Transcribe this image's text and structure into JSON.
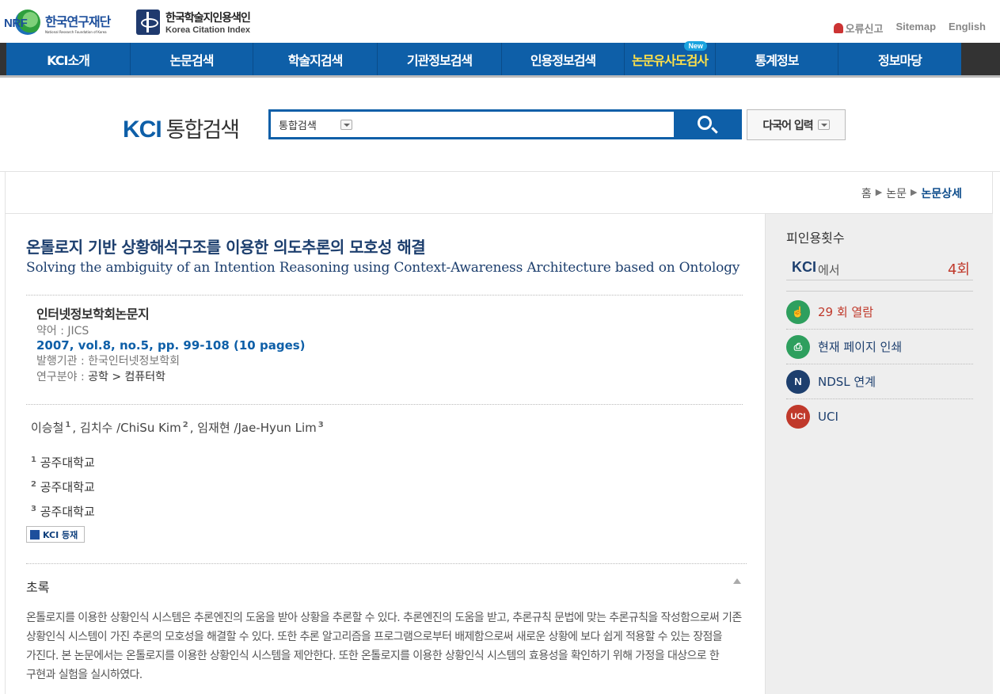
{
  "header": {
    "nrf_mark": "NRF",
    "nrf_name_ko": "한국연구재단",
    "nrf_name_en": "National Research Foundation of Korea",
    "kci_name_ko": "한국학술지인용색인",
    "kci_name_en": "Korea Citation Index",
    "util": {
      "report": "오류신고",
      "sitemap": "Sitemap",
      "english": "English"
    }
  },
  "nav": {
    "items": [
      "KCI소개",
      "논문검색",
      "학술지검색",
      "기관정보검색",
      "인용정보검색",
      "논문유사도검사",
      "통계정보",
      "정보마당"
    ],
    "new_badge": "New"
  },
  "search": {
    "logo_kci": "KCI",
    "logo_text": "통합검색",
    "scope": "통합검색",
    "multi_input": "다국어 입력"
  },
  "breadcrumb": [
    "홈",
    "논문",
    "논문상세"
  ],
  "article": {
    "title_ko": "온톨로지 기반 상황해석구조를 이용한 의도추론의 모호성 해결",
    "title_en": "Solving the ambiguity of an Intention Reasoning using Context-Awareness Architecture based on Ontology",
    "journal": "인터넷정보학회논문지",
    "abbr": "약어 : JICS",
    "volume": "2007, vol.8, no.5, pp. 99-108 (10 pages)",
    "publisher": "발행기관 : 한국인터넷정보학회",
    "field_label": "연구분야 : ",
    "field_value": "공학 > 컴퓨터학",
    "authors": [
      {
        "name": "이승철",
        "sup": "1"
      },
      {
        "name": "김치수 /ChiSu Kim",
        "sup": "2"
      },
      {
        "name": "임재현 /Jae-Hyun Lim",
        "sup": "3"
      }
    ],
    "affiliations": [
      {
        "sup": "1",
        "name": "공주대학교"
      },
      {
        "sup": "2",
        "name": "공주대학교"
      },
      {
        "sup": "3",
        "name": "공주대학교"
      }
    ],
    "kci_badge": "KCI 등재",
    "abstract_title": "초록",
    "abstract": "온톨로지를 이용한 상황인식 시스템은 추론엔진의 도움을 받아 상황을 추론할 수 있다. 추론엔진의 도움을 받고, 추론규칙 문법에 맞는 추론규칙을 작성함으로써 기존 상황인식 시스템이 가진 추론의 모호성을 해결할 수 있다. 또한 추론 알고리즘을 프로그램으로부터 배제함으로써 새로운 상황에 보다 쉽게 적용할 수 있는 장점을 가진다. 본 논문에서는 온톨로지를 이용한 상황인식 시스템을 제안한다. 또한 온톨로지를 이용한 상황인식 시스템의 효용성을 확인하기 위해 가정을 대상으로 한 구현과 실험을 실시하였다."
  },
  "side": {
    "cited_heading": "피인용횟수",
    "cited_source": "KCI",
    "cited_suffix": "에서",
    "cited_count": "4회",
    "views": "29 회 열람",
    "print": "현재 페이지 인쇄",
    "ndsl": "NDSL 연계",
    "uci": "UCI",
    "icons": {
      "views": "hand-pointer-icon",
      "print": "printer-icon",
      "ndsl": "ndsl-logo-icon",
      "uci": "uci-logo-icon"
    },
    "colors": {
      "views": "#2e9f5e",
      "print": "#2e9f5e",
      "ndsl": "#1d3f6e",
      "uci": "#c0392b"
    }
  }
}
